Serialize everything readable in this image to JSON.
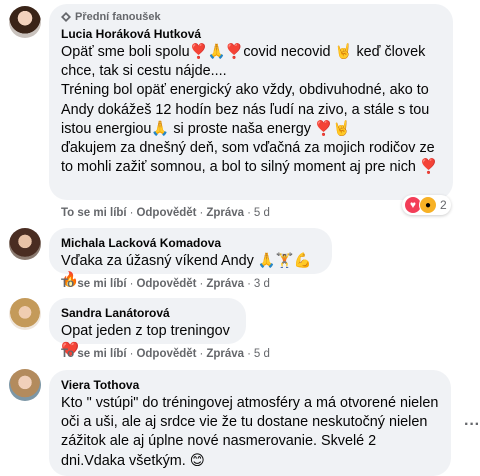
{
  "comments": [
    {
      "badge": "Přední fanoušek",
      "author": "Lucia Horáková Hutková",
      "text": "Opäť sme boli spolu❣️🙏❣️covid necovid 🤘 keď človek chce, tak si cestu nájde....\nTréning bol opäť energický ako vždy, obdivuhodné, ako to Andy dokážeš 12 hodín bez nás ľudí na zivo, a stále s tou istou energiou🙏 si proste naša energy ❣️🤘\nďakujem za dnešný deň, som vďačná za mojich rodičov ze to mohli zažiť somnou, a bol to silný moment aj pre nich ❣️",
      "actions": {
        "like": "To se mi líbí",
        "reply": "Odpovědět",
        "message": "Zpráva",
        "time": "5 d"
      },
      "reactions": {
        "icons": [
          "love-icon",
          "wow-icon"
        ],
        "count": "2"
      }
    },
    {
      "author": "Michala Lacková Komadova",
      "text": "Vďaka za úžasný víkend Andy 🙏🏋️💪🔥",
      "actions": {
        "like": "To se mi líbí",
        "reply": "Odpovědět",
        "message": "Zpráva",
        "time": "3 d"
      }
    },
    {
      "author": "Sandra Lanátorová",
      "text": "Opat jeden z top treningov❤️",
      "actions": {
        "like": "To se mi líbí",
        "reply": "Odpovědět",
        "message": "Zpráva",
        "time": "5 d"
      }
    },
    {
      "author": "Viera Tothova",
      "text": "Kto \" vstúpi\" do tréningovej atmosféry a má otvorené nielen oči a uši, ale aj srdce vie že tu dostane neskutočný nielen zážitok ale aj úplne nové nasmerovanie. Skvelé 2 dni.Vdaka všetkým. 😊"
    }
  ],
  "icons": {
    "more": "more-options-icon",
    "badge": "fan-badge-icon"
  }
}
